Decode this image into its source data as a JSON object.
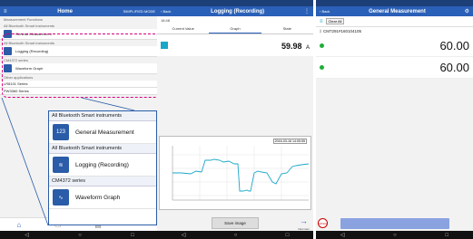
{
  "phone1": {
    "header_title": "Home",
    "header_right": "SIMPLIFIED MODE",
    "section_measurement": "Measurement Functions",
    "section_all_bt": "All Bluetooth Smart instruments",
    "section_cm4372": "CM4372 series",
    "section_other": "Other applications",
    "items": [
      "General Measurement",
      "Logging (Recording)",
      "Waveform Graph"
    ],
    "other_series_1": "LR8101 Series",
    "other_series_2": "PW3360 Series"
  },
  "zoom": {
    "section1": "All Bluetooth Smart instruments",
    "item1": "General Measurement",
    "item2": "Logging (Recording)",
    "section2": "CM4372 series",
    "item3": "Waveform Graph"
  },
  "phone2": {
    "back": "Back",
    "title": "Logging (Recording)",
    "subhead": "18:48",
    "tabs": [
      "Current Value",
      "Graph",
      "State"
    ],
    "value": "59.98",
    "unit": "A",
    "timestamp": "2016-03-16 14:05:55",
    "save_label": "Save image",
    "next_label": "Next item"
  },
  "phone3": {
    "back": "Back",
    "title": "General Measurement",
    "clear_label": "Clear All",
    "device_id": "CM7291#160104105",
    "value1": "60.00",
    "value2": "60.00",
    "hold_label": "HOLD"
  },
  "colors": {
    "header": "#2a60b7",
    "status": "#1c3f78",
    "accent": "#d6007e",
    "cyan": "#1aa7c9",
    "green": "#1fae3a"
  }
}
